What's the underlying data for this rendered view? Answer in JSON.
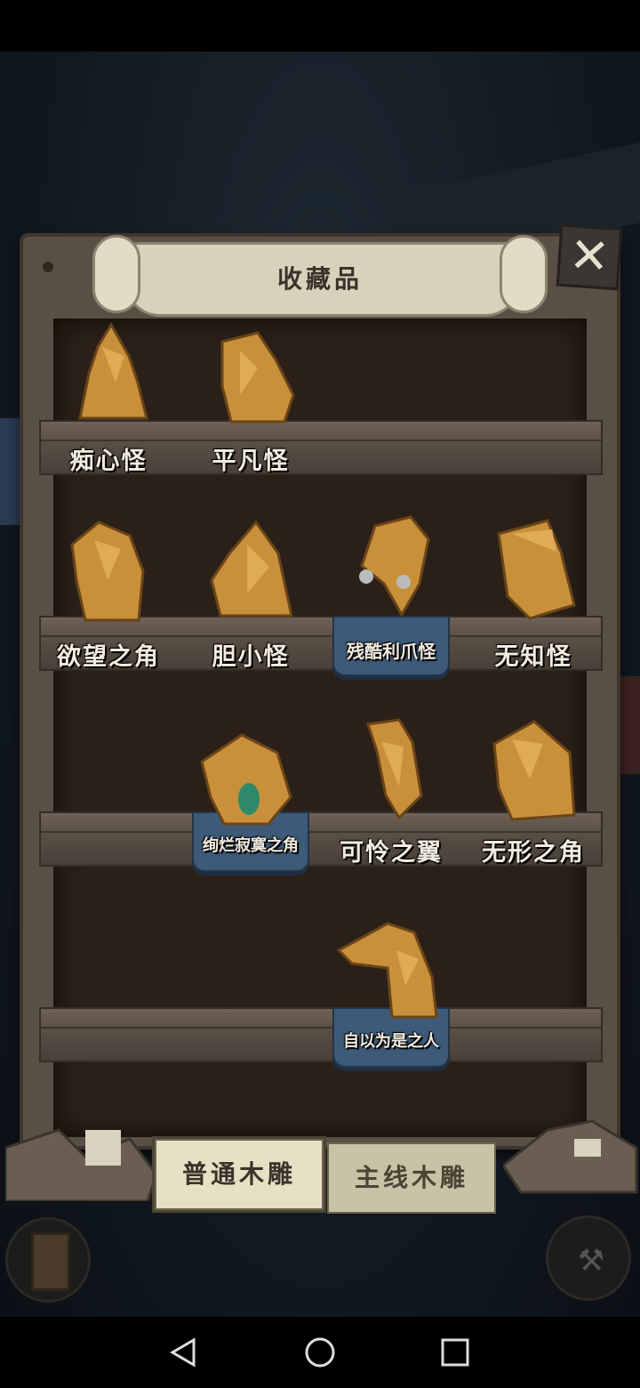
{
  "panel": {
    "title": "收藏品",
    "close_icon": "close-icon"
  },
  "shelves": [
    {
      "items": [
        {
          "slot": 1,
          "label": "痴心怪",
          "highlighted": false
        },
        {
          "slot": 2,
          "label": "平凡怪",
          "highlighted": false
        }
      ]
    },
    {
      "items": [
        {
          "slot": 1,
          "label": "欲望之角",
          "highlighted": false
        },
        {
          "slot": 2,
          "label": "胆小怪",
          "highlighted": false
        },
        {
          "slot": 3,
          "label": "残酷利爪怪",
          "highlighted": true
        },
        {
          "slot": 4,
          "label": "无知怪",
          "highlighted": false
        }
      ]
    },
    {
      "items": [
        {
          "slot": 2,
          "label": "绚烂寂寞之角",
          "highlighted": true
        },
        {
          "slot": 3,
          "label": "可怜之翼",
          "highlighted": false
        },
        {
          "slot": 4,
          "label": "无形之角",
          "highlighted": false
        }
      ]
    },
    {
      "items": [
        {
          "slot": 3,
          "label": "自以为是之人",
          "highlighted": true
        }
      ]
    }
  ],
  "tabs": [
    {
      "label": "普通木雕",
      "active": true
    },
    {
      "label": "主线木雕",
      "active": false
    }
  ],
  "colors": {
    "carving_gold": "#c8903a",
    "highlight_plate": "#3d5a78",
    "shelf_wood": "#5a4f45"
  }
}
